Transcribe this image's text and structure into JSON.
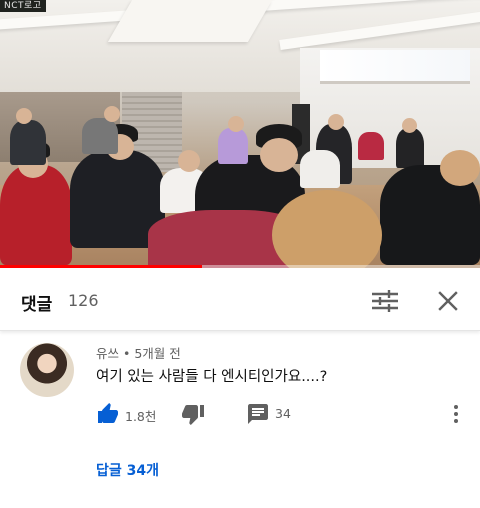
{
  "video": {
    "watermark_text": "NCT로고",
    "progress_fraction": 0.42,
    "colors": {
      "progress": "#ff0000"
    }
  },
  "comments_header": {
    "title": "댓글",
    "count": "126",
    "sort_icon": "sort-sliders-icon",
    "close_icon": "close-icon"
  },
  "comment": {
    "author": "유쓰",
    "separator": " • ",
    "time": "5개월 전",
    "text": "여기 있는 사람들 다 엔시티인가요....?",
    "like_count": "1.8천",
    "reply_count": "34",
    "replies_link": "답글 34개",
    "icons": {
      "like": "thumbs-up-icon",
      "dislike": "thumbs-down-icon",
      "reply": "comment-icon",
      "more": "more-vertical-icon"
    },
    "colors": {
      "like_active": "#065fd4",
      "link": "#065fd4",
      "icon": "#606060"
    }
  }
}
